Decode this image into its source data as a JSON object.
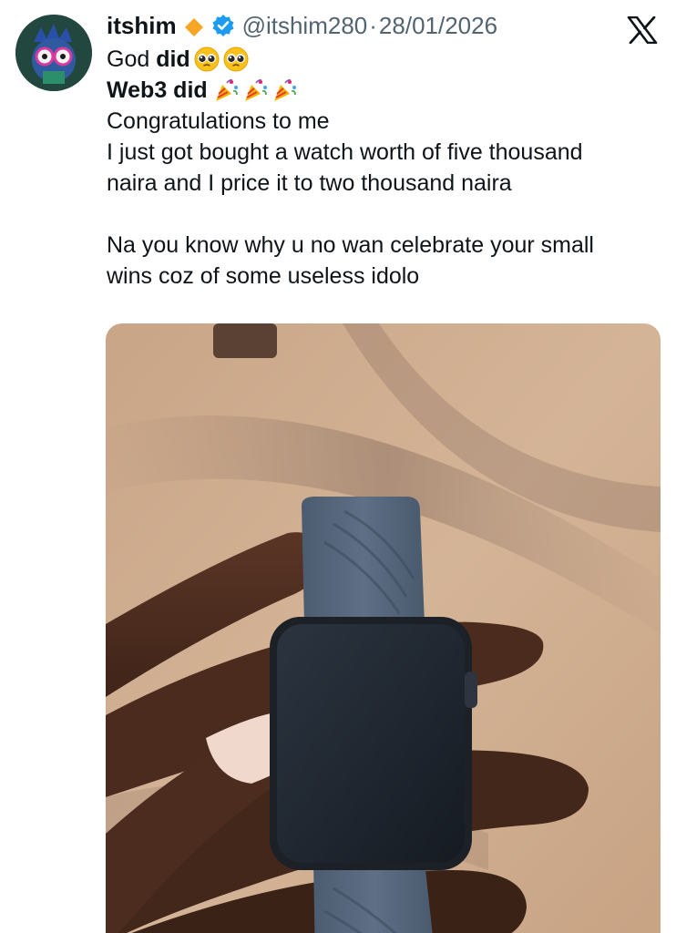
{
  "tweet": {
    "display_name": "itshim",
    "handle": "@itshim280",
    "separator": "·",
    "date": "28/01/2026",
    "lines": {
      "l1_prefix": "God ",
      "l1_bold": "did",
      "l2_bold": "Web3 did",
      "l3": "Congratulations to me",
      "l4": "I just got bought a watch worth of five thousand",
      "l5": "naira and I price it to two thousand naira",
      "l6": "Na you know why u no wan celebrate your small",
      "l7": "wins coz of some useless idolo"
    }
  },
  "icons": {
    "avatar": "avatar-icon",
    "diamond": "orange-diamond-icon",
    "verified": "verified-badge-icon",
    "platform": "x-logo-icon",
    "pleading_face": "pleading-face-emoji",
    "party_popper": "party-popper-emoji"
  },
  "colors": {
    "text": "#0f1419",
    "muted": "#536471",
    "verified_blue": "#1d9bf0",
    "diamond_orange": "#f5a623"
  }
}
